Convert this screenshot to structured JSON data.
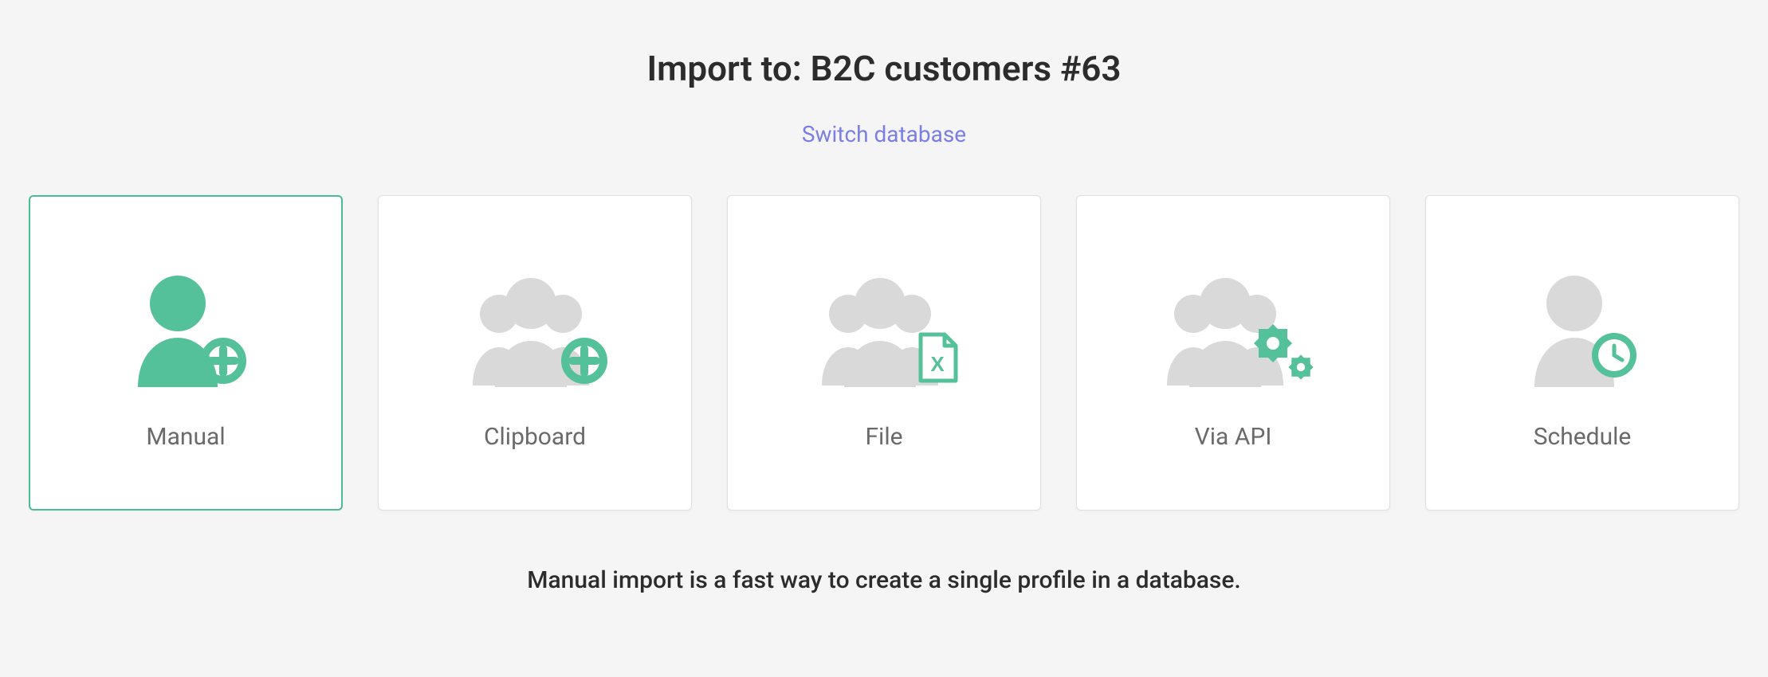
{
  "header": {
    "title": "Import to: B2C customers #63",
    "switch_link": "Switch database"
  },
  "tiles": [
    {
      "label": "Manual",
      "selected": true
    },
    {
      "label": "Clipboard",
      "selected": false
    },
    {
      "label": "File",
      "selected": false
    },
    {
      "label": "Via API",
      "selected": false
    },
    {
      "label": "Schedule",
      "selected": false
    }
  ],
  "description": "Manual import is a fast way to create a single profile in a database.",
  "colors": {
    "accent": "#4cbc93",
    "link": "#7a7ee6",
    "muted_icon": "#d9d9d9"
  }
}
